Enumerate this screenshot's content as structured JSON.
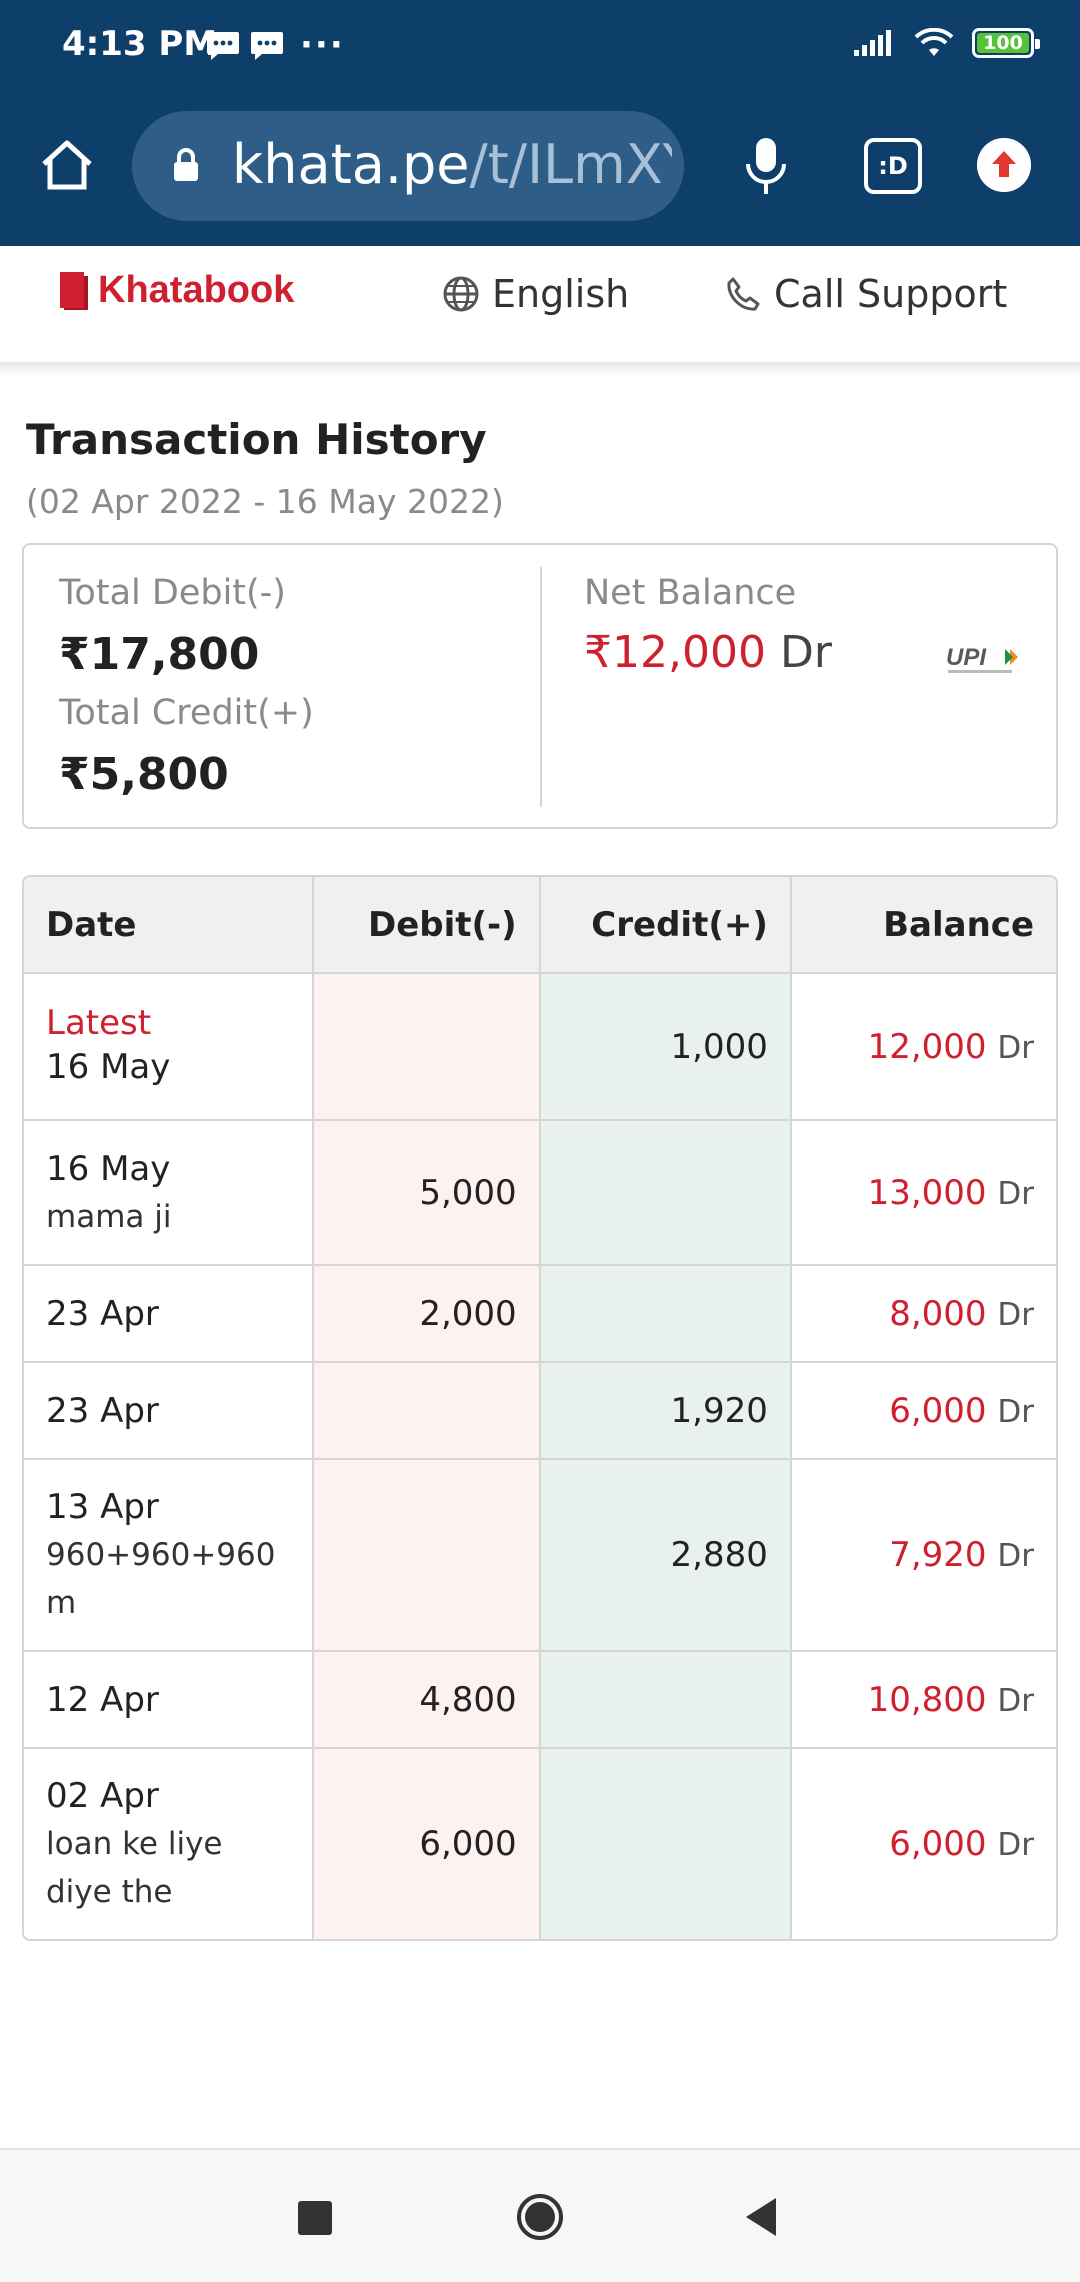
{
  "status_bar": {
    "time": "4:13 PM",
    "dots": "···",
    "battery": "100",
    "icons": [
      "message-icon",
      "message-icon",
      "signal-icon",
      "wifi-icon",
      "battery-icon"
    ]
  },
  "browser": {
    "url_domain": "khata.pe",
    "url_path": "/t/ILmXY",
    "tabs_label": ":D",
    "icons": [
      "home-icon",
      "lock-icon",
      "mic-icon",
      "tabs-icon",
      "upload-icon"
    ]
  },
  "site_header": {
    "brand": "Khatabook",
    "language": "English",
    "support": "Call Support",
    "brand_color": "#cf2030"
  },
  "page": {
    "title": "Transaction History",
    "date_range": "(02 Apr 2022 - 16 May 2022)"
  },
  "summary": {
    "total_debit_label": "Total Debit(-)",
    "total_debit_value": "₹17,800",
    "total_credit_label": "Total Credit(+)",
    "total_credit_value": "₹5,800",
    "net_balance_label": "Net Balance",
    "net_balance_value": "₹12,000",
    "net_balance_suffix": "Dr",
    "upi_logo": "UPI"
  },
  "table": {
    "headers": {
      "date": "Date",
      "debit": "Debit(-)",
      "credit": "Credit(+)",
      "balance": "Balance"
    },
    "rows": [
      {
        "tag": "Latest",
        "date": "16 May",
        "note": "",
        "debit": "",
        "credit": "1,000",
        "balance": "12,000",
        "suffix": "Dr"
      },
      {
        "tag": "",
        "date": "16 May",
        "note": "mama ji",
        "debit": "5,000",
        "credit": "",
        "balance": "13,000",
        "suffix": "Dr"
      },
      {
        "tag": "",
        "date": "23 Apr",
        "note": "",
        "debit": "2,000",
        "credit": "",
        "balance": "8,000",
        "suffix": "Dr"
      },
      {
        "tag": "",
        "date": "23 Apr",
        "note": "",
        "debit": "",
        "credit": "1,920",
        "balance": "6,000",
        "suffix": "Dr"
      },
      {
        "tag": "",
        "date": "13 Apr",
        "note": "960+960+960 m",
        "debit": "",
        "credit": "2,880",
        "balance": "7,920",
        "suffix": "Dr"
      },
      {
        "tag": "",
        "date": "12 Apr",
        "note": "",
        "debit": "4,800",
        "credit": "",
        "balance": "10,800",
        "suffix": "Dr"
      },
      {
        "tag": "",
        "date": "02 Apr",
        "note": "loan ke liye diye the",
        "debit": "6,000",
        "credit": "",
        "balance": "6,000",
        "suffix": "Dr"
      }
    ]
  },
  "nav_bar": {
    "icons": [
      "recents-icon",
      "home-circle-icon",
      "back-icon"
    ]
  }
}
